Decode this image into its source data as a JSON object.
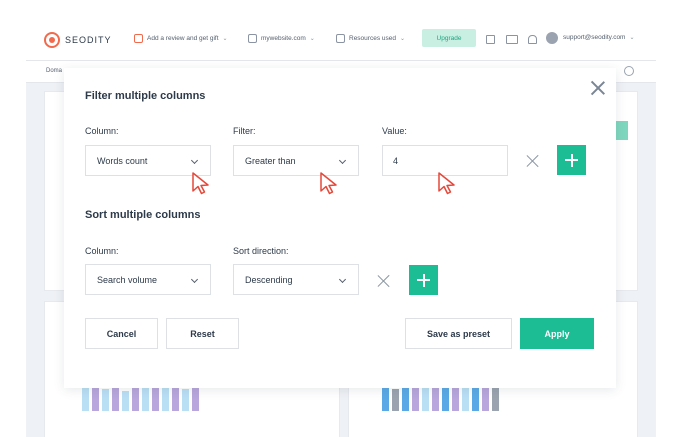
{
  "app": {
    "logo_text": "SEODITY",
    "review_label": "Add a review and get gift",
    "website_label": "mywebsite.com",
    "resources_label": "Resources used",
    "upgrade_label": "Upgrade",
    "account_email": "support@seodity.com",
    "domain_label": "Doma"
  },
  "modal": {
    "filter_title": "Filter multiple columns",
    "filter": {
      "column_label": "Column:",
      "column_value": "Words count",
      "filter_label": "Filter:",
      "filter_value": "Greater than",
      "value_label": "Value:",
      "value_value": "4"
    },
    "sort_title": "Sort multiple columns",
    "sort": {
      "column_label": "Column:",
      "column_value": "Search volume",
      "direction_label": "Sort direction:",
      "direction_value": "Descending"
    },
    "buttons": {
      "cancel": "Cancel",
      "reset": "Reset",
      "save_preset": "Save as preset",
      "apply": "Apply"
    }
  },
  "colors": {
    "accent": "#1cbc94",
    "cursor": "#e5483a",
    "brand": "#f26a4b"
  },
  "icons": {
    "close": "close-icon",
    "remove": "remove-filter-icon",
    "add": "plus-icon",
    "cursor": "mouse-pointer-icon"
  }
}
